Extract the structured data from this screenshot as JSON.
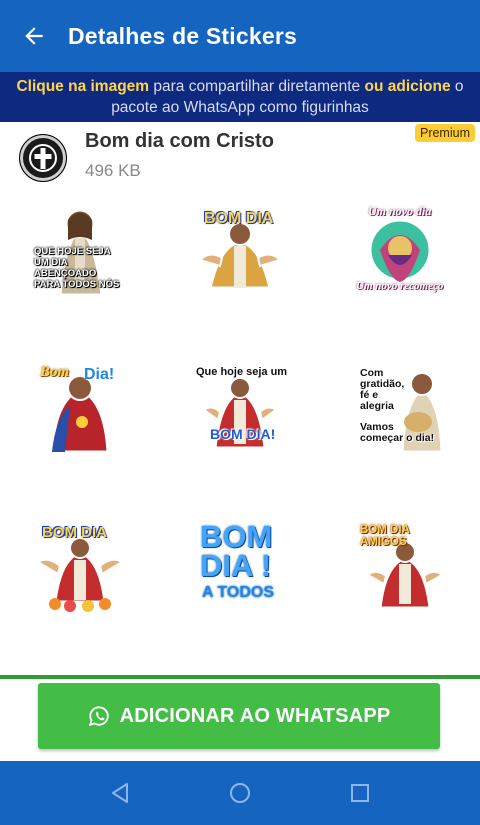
{
  "appbar": {
    "title": "Detalhes de Stickers",
    "back_icon": "arrow-back-icon"
  },
  "banner": {
    "bold1": "Clique na imagem",
    "text1": " para compartilhar diretamente ",
    "bold2": "ou adicione",
    "text2": " o pacote ao WhatsApp como figurinhas"
  },
  "pack": {
    "name": "Bom dia com Cristo",
    "size": "496 KB",
    "badge": "Premium",
    "icon": "cross-icon"
  },
  "stickers": [
    {
      "name": "sticker-que-hoje-seja",
      "lines": [
        "QUE HOJE SEJA",
        "UM DIA ABENÇOADO",
        "PARA TODOS NÓS"
      ]
    },
    {
      "name": "sticker-bom-dia-jesus",
      "lines": [
        "BOM DIA"
      ]
    },
    {
      "name": "sticker-um-novo-dia",
      "lines": [
        "Um novo dia",
        "Um novo recomeço"
      ]
    },
    {
      "name": "sticker-bom-dia-sacred-heart",
      "lines": [
        "Bom",
        "Dia!"
      ]
    },
    {
      "name": "sticker-que-hoje-seja-um-bom-dia",
      "lines": [
        "Que hoje seja um",
        "BOM DIA!"
      ]
    },
    {
      "name": "sticker-com-gratidao",
      "lines": [
        "Com",
        "gratidão,",
        "fé e",
        "alegria",
        "Vamos",
        "começar o dia!"
      ]
    },
    {
      "name": "sticker-bom-dia-flowers",
      "lines": [
        "BOM DIA"
      ]
    },
    {
      "name": "sticker-bom-dia-a-todos",
      "lines": [
        "BOM",
        "DIA !",
        "A TODOS"
      ]
    },
    {
      "name": "sticker-bom-dia-amigos",
      "lines": [
        "BOM DIA",
        "AMIGOS"
      ]
    }
  ],
  "add_button": {
    "label": "ADICIONAR AO WHATSAPP",
    "icon": "whatsapp-icon"
  },
  "navbar": {
    "back": "nav-back-icon",
    "home": "nav-home-icon",
    "recents": "nav-recents-icon"
  },
  "colors": {
    "primary": "#1565c0",
    "banner": "#0d2a80",
    "accent": "#ffd54f",
    "whatsapp_green": "#43bd46",
    "premium": "#ffcc33"
  }
}
